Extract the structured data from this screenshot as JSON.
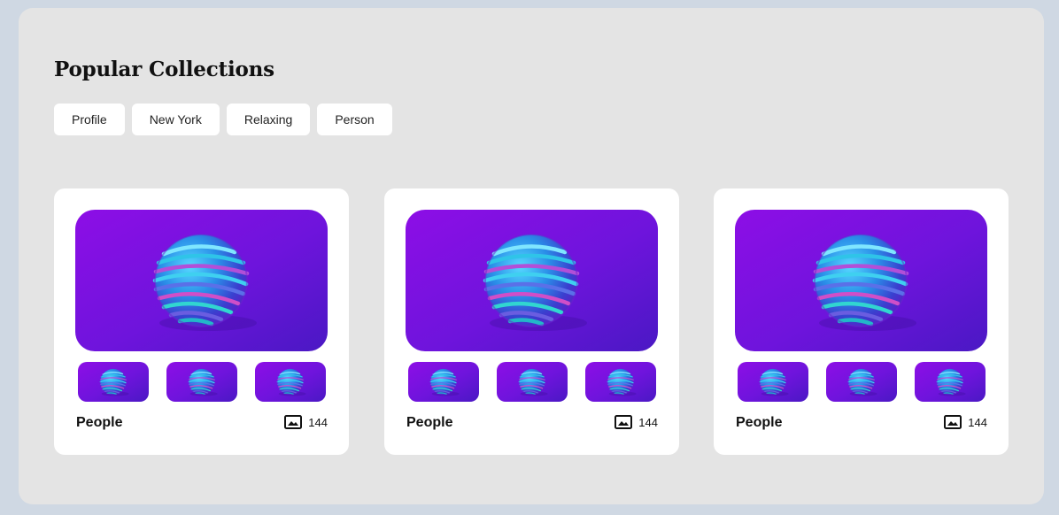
{
  "section": {
    "title": "Popular Collections"
  },
  "tags": [
    {
      "label": "Profile"
    },
    {
      "label": "New York"
    },
    {
      "label": "Relaxing"
    },
    {
      "label": "Person"
    }
  ],
  "collections": [
    {
      "name": "People",
      "count": "144",
      "icon": "image-icon"
    },
    {
      "name": "People",
      "count": "144",
      "icon": "image-icon"
    },
    {
      "name": "People",
      "count": "144",
      "icon": "image-icon"
    }
  ],
  "colors": {
    "page_bg": "#cfd8e3",
    "panel_bg": "#e4e4e4",
    "card_bg": "#ffffff",
    "art_purple": "#7b12e8",
    "art_teal": "#1fc6d8"
  }
}
